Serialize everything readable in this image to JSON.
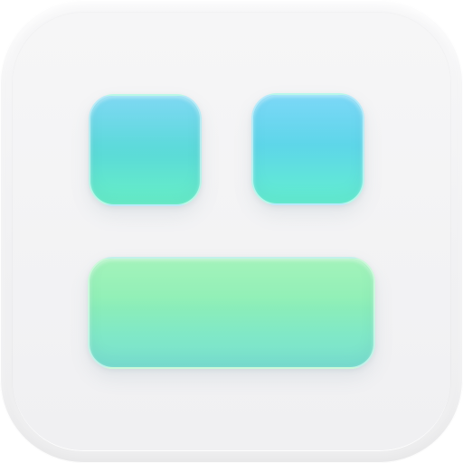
{
  "app_icon": {
    "shape": "rounded-square",
    "background": "#f2f2f4",
    "tiles": [
      {
        "name": "top-left",
        "colors": [
          "#62d0f0",
          "#67f0c7"
        ]
      },
      {
        "name": "top-right",
        "colors": [
          "#5fcff5",
          "#63efcf"
        ]
      },
      {
        "name": "bottom-wide",
        "colors": [
          "#8ff0ac",
          "#79e0d0"
        ]
      }
    ]
  }
}
